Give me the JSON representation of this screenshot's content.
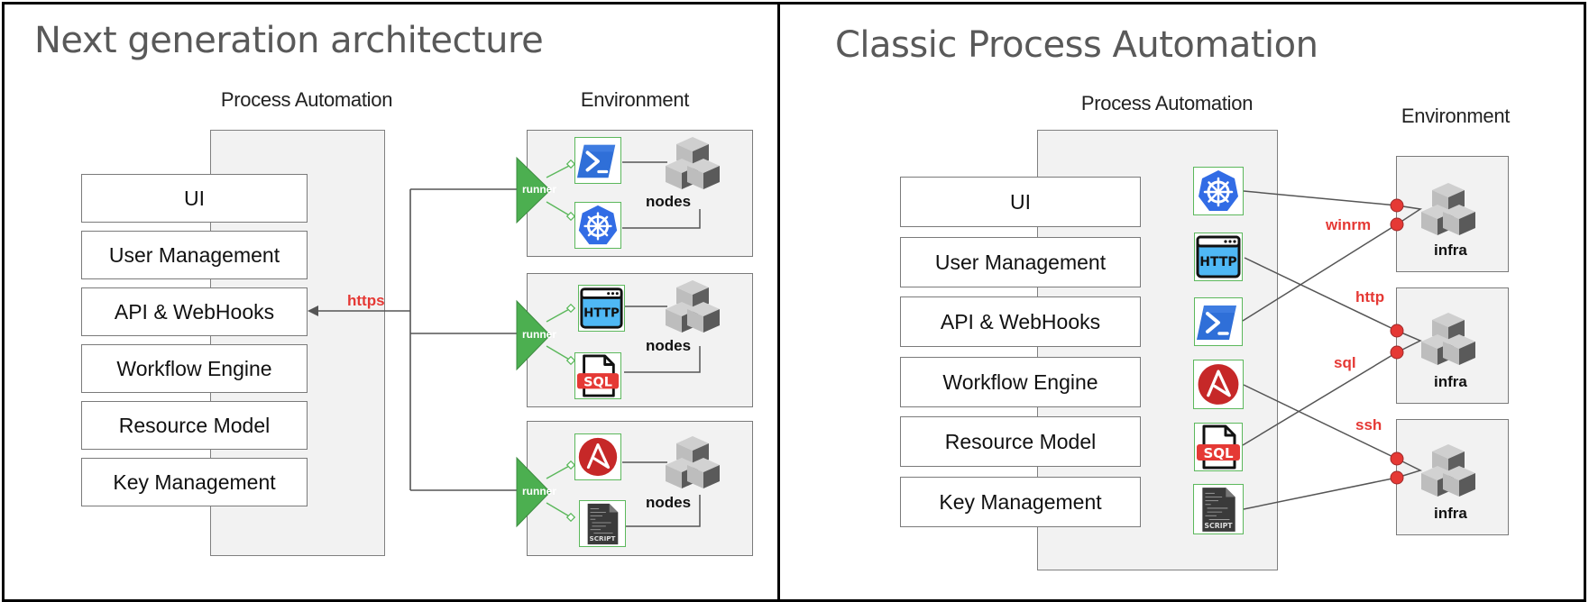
{
  "left_panel": {
    "title": "Next generation architecture",
    "process_automation_label": "Process Automation",
    "environment_label": "Environment",
    "modules": [
      "UI",
      "User Management",
      "API & WebHooks",
      "Workflow Engine",
      "Resource Model",
      "Key Management"
    ],
    "connection_label": "https",
    "environments": [
      {
        "runner_label": "runner",
        "nodes_label": "nodes",
        "plugins": [
          "powershell-icon",
          "kubernetes-icon"
        ]
      },
      {
        "runner_label": "runner",
        "nodes_label": "nodes",
        "plugins": [
          "http-icon",
          "sql-icon"
        ]
      },
      {
        "runner_label": "runner",
        "nodes_label": "nodes",
        "plugins": [
          "ansible-icon",
          "script-icon"
        ]
      }
    ]
  },
  "right_panel": {
    "title": "Classic Process Automation",
    "process_automation_label": "Process Automation",
    "environment_label": "Environment",
    "modules": [
      "UI",
      "User Management",
      "API & WebHooks",
      "Workflow Engine",
      "Resource Model",
      "Key Management"
    ],
    "plugins": [
      "kubernetes-icon",
      "http-icon",
      "powershell-icon",
      "ansible-icon",
      "sql-icon",
      "script-icon"
    ],
    "protocols": [
      "winrm",
      "http",
      "sql",
      "ssh"
    ],
    "infra_labels": [
      "infra",
      "infra",
      "infra"
    ]
  },
  "colors": {
    "runner_green": "#4caf50",
    "protocol_red": "#e53935",
    "tile_border_green": "#5cb85c",
    "panel_gray": "#f2f2f2",
    "title_gray": "#595959"
  }
}
